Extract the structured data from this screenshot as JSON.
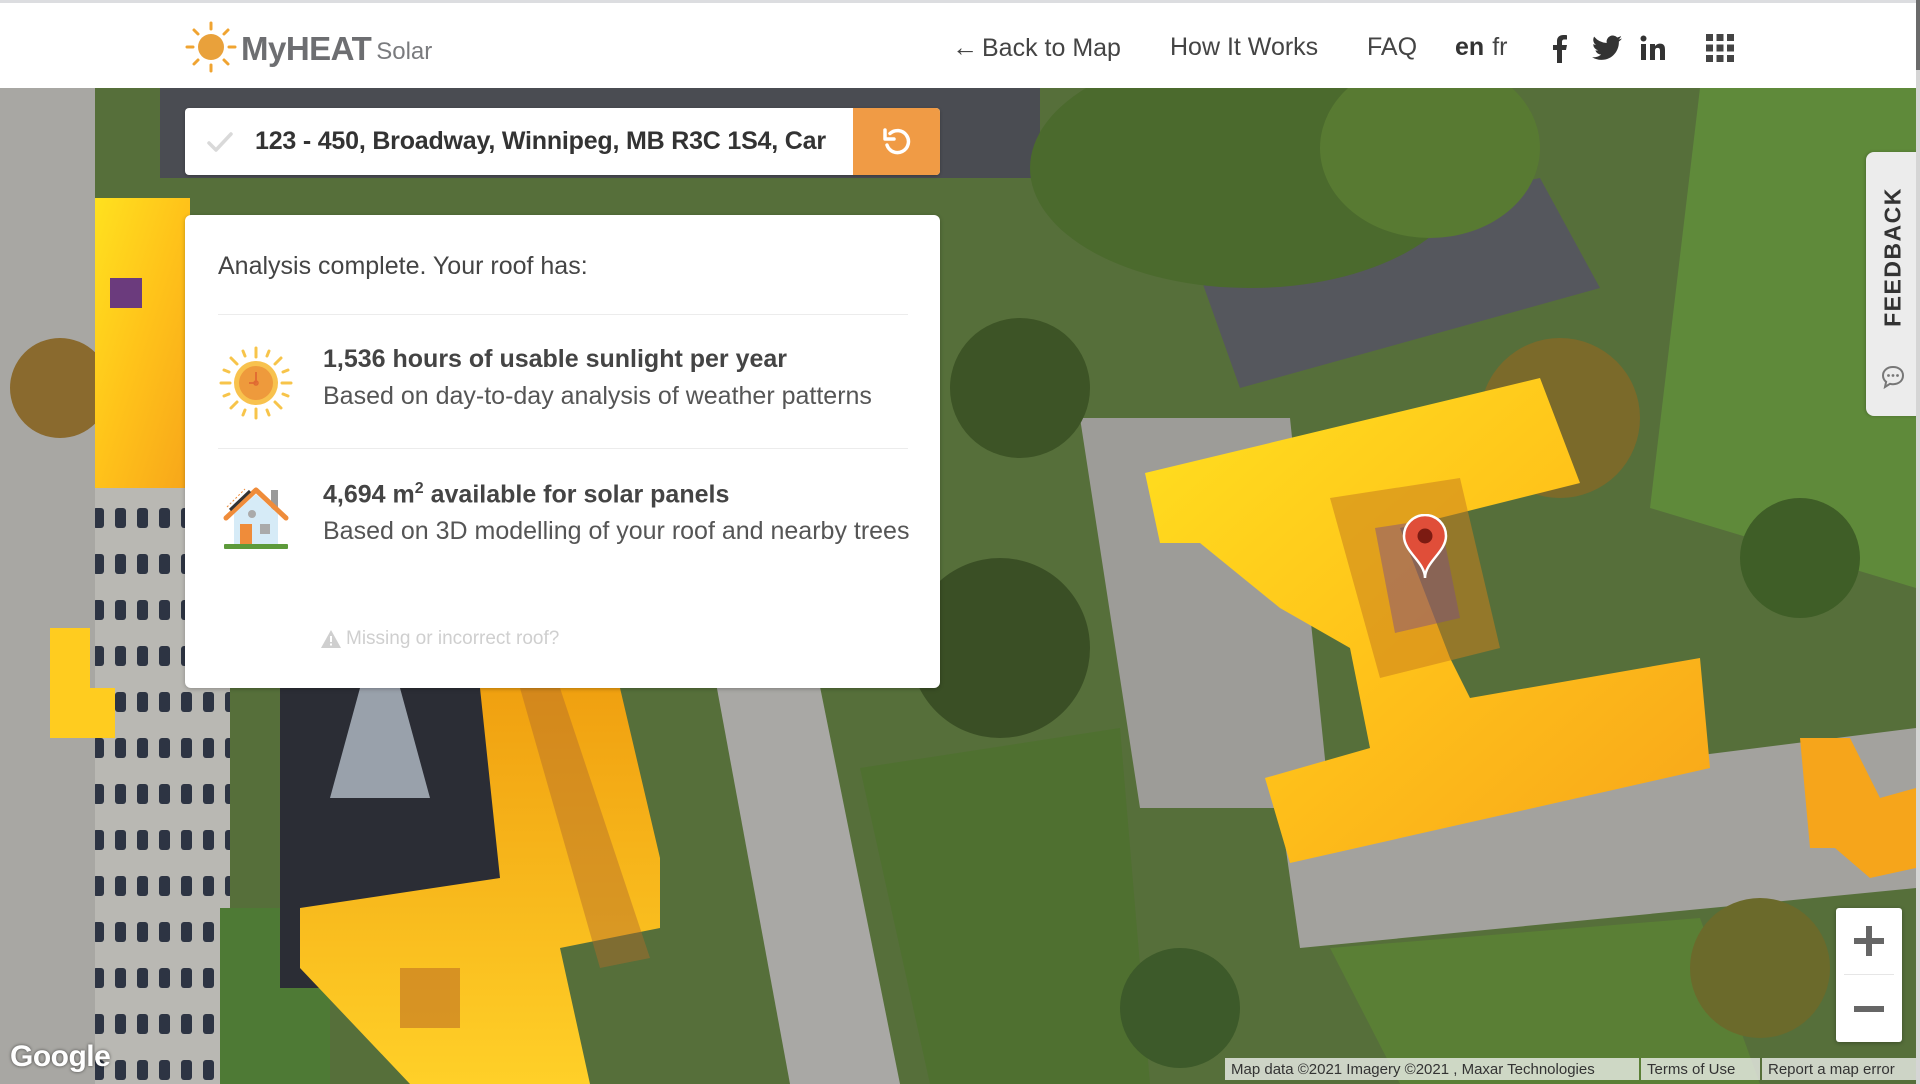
{
  "header": {
    "logo": {
      "brand": "MyHEAT",
      "product": "Solar",
      "icon": "sun-icon"
    },
    "nav": {
      "back_arrow": "←",
      "back_label": "Back to Map",
      "how_it_works": "How It Works",
      "faq": "FAQ",
      "lang_en": "en",
      "lang_fr": "fr"
    },
    "social": [
      "facebook-icon",
      "twitter-icon",
      "linkedin-icon"
    ],
    "apps_icon": "apps-grid-icon"
  },
  "search": {
    "status_icon": "checkmark-icon",
    "address": "123 - 450, Broadway, Winnipeg, MB R3C 1S4, Car",
    "reset_icon": "reset-icon"
  },
  "result_card": {
    "intro": "Analysis complete. Your roof has:",
    "stats": [
      {
        "icon": "sun-clock-icon",
        "title": "1,536 hours of usable sunlight per year",
        "description": "Based on day-to-day analysis of weather patterns"
      },
      {
        "icon": "house-solar-icon",
        "title_value": "4,694 m",
        "title_sup": "2",
        "title_rest": " available for solar panels",
        "description": "Based on 3D modelling of your roof and nearby trees"
      }
    ],
    "missing_roof_link": "Missing or incorrect roof?"
  },
  "feedback_tab": {
    "label": "FEEDBACK",
    "icon": "chat-bubble-icon"
  },
  "map": {
    "zoom_in": "+",
    "zoom_out": "−",
    "google_logo": "Google",
    "attribution": "Map data ©2021 Imagery ©2021 , Maxar Technologies",
    "terms": "Terms of Use",
    "report": "Report a map error",
    "marker_color": "#e04e39"
  },
  "colors": {
    "accent_orange": "#f09b45",
    "text_dark": "#444444",
    "heat_yellow": "#ffd21a",
    "heat_orange": "#f5a00f"
  }
}
